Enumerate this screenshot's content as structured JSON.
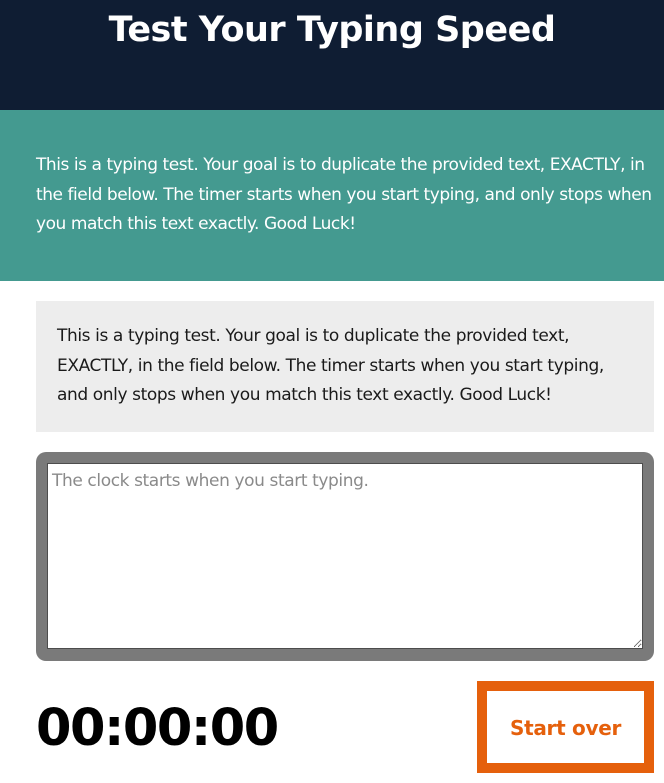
{
  "header": {
    "title": "Test Your Typing Speed"
  },
  "intro": {
    "text": "This is a typing test. Your goal is to duplicate the provided text, EXACTLY, in the field below. The timer starts when you start typing, and only stops when you match this text exactly. Good Luck!"
  },
  "test": {
    "origin_text": "This is a typing test. Your goal is to duplicate the provided text, EXACTLY, in the field below. The timer starts when you start typing, and only stops when you match this text exactly. Good Luck!",
    "input_value": "",
    "input_placeholder": "The clock starts when you start typing.",
    "timer": "00:00:00",
    "reset_label": "Start over"
  },
  "colors": {
    "header_bg": "#0f1d33",
    "intro_bg": "#449a90",
    "origin_bg": "#ededed",
    "input_frame": "#7a7a7a",
    "accent": "#e5600c"
  }
}
